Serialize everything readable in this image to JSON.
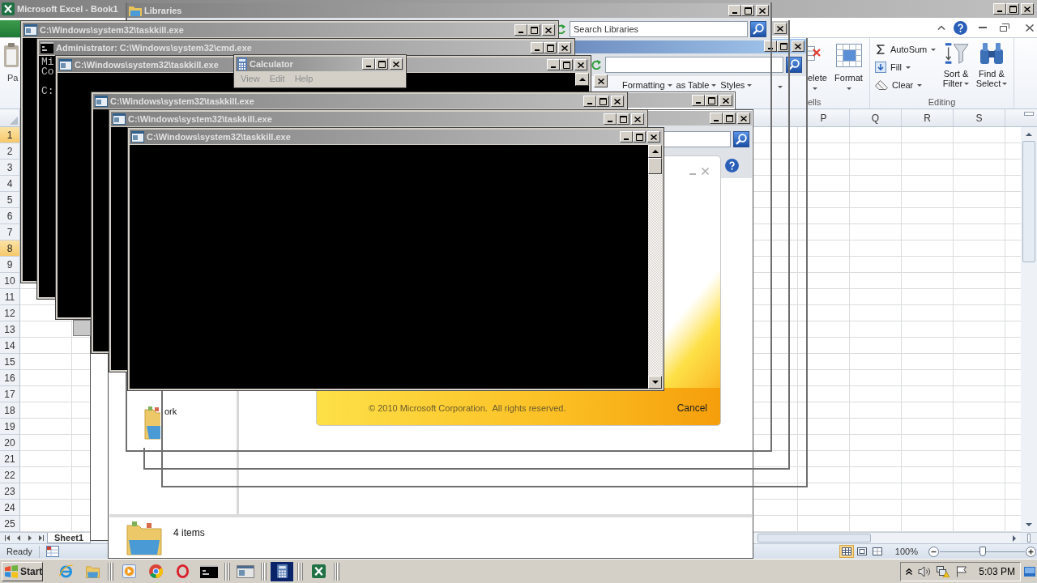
{
  "excel": {
    "title": "Microsoft Excel - Book1",
    "active": false,
    "ribbon": {
      "paste_label": "Pa",
      "styles": [
        "Formatting",
        "as Table",
        "Styles"
      ],
      "cells": {
        "delete_label": "elete",
        "format_label": "Format",
        "group_label": "ells"
      },
      "editing": {
        "commands": [
          {
            "kind": "sum",
            "label": "AutoSum"
          },
          {
            "kind": "fill",
            "label": "Fill"
          },
          {
            "kind": "clear",
            "label": "Clear"
          }
        ],
        "sort_lines": [
          "Sort &",
          "Filter"
        ],
        "find_lines": [
          "Find &",
          "Select"
        ],
        "group_label": "Editing"
      }
    },
    "columns": [
      "P",
      "Q",
      "R",
      "S"
    ],
    "rows": [
      {
        "label": "1",
        "selected": true
      },
      {
        "label": "2",
        "selected": false
      },
      {
        "label": "3",
        "selected": false
      },
      {
        "label": "4",
        "selected": false
      },
      {
        "label": "5",
        "selected": false
      },
      {
        "label": "6",
        "selected": false
      },
      {
        "label": "7",
        "selected": false
      },
      {
        "label": "8",
        "selected": true
      },
      {
        "label": "9",
        "selected": false
      },
      {
        "label": "10",
        "selected": false
      },
      {
        "label": "11",
        "selected": false
      },
      {
        "label": "12",
        "selected": false
      },
      {
        "label": "13",
        "selected": false
      },
      {
        "label": "14",
        "selected": false
      },
      {
        "label": "15",
        "selected": false
      },
      {
        "label": "16",
        "selected": false
      },
      {
        "label": "17",
        "selected": false
      },
      {
        "label": "18",
        "selected": false
      },
      {
        "label": "19",
        "selected": false
      },
      {
        "label": "20",
        "selected": false
      },
      {
        "label": "21",
        "selected": false
      },
      {
        "label": "22",
        "selected": false
      },
      {
        "label": "23",
        "selected": false
      },
      {
        "label": "24",
        "selected": false
      },
      {
        "label": "25",
        "selected": false
      }
    ],
    "sheet_tabs": [
      {
        "label": "Sheet1",
        "selected": true
      }
    ],
    "status": "Ready",
    "views": [
      {
        "kind": "normal",
        "selected": true
      },
      {
        "kind": "layout",
        "selected": false
      },
      {
        "kind": "breaks",
        "selected": false
      }
    ],
    "zoom": {
      "reading": "100%",
      "level": 0.5
    }
  },
  "windows": [
    {
      "kind": "explorer",
      "active": false,
      "title": "Libraries",
      "search": {
        "placeholder": "Search Libraries"
      }
    },
    {
      "kind": "console",
      "active": false,
      "title": "C:\\Windows\\system32\\taskkill.exe"
    },
    {
      "kind": "explorer",
      "active": false
    },
    {
      "kind": "prompt",
      "active": false,
      "title": "Administrator: C:\\Windows\\system32\\cmd.exe",
      "output": "Mi\nCo\n\nC:"
    },
    {
      "kind": "explorer",
      "active": true
    },
    {
      "kind": "console",
      "active": false,
      "title": "C:\\Windows\\system32\\taskkill.exe"
    },
    {
      "kind": "calculator",
      "active": false,
      "title": "Calculator",
      "menu": [
        {
          "label": "View",
          "disabled": true
        },
        {
          "label": "Edit",
          "disabled": true
        },
        {
          "label": "Help",
          "disabled": true
        }
      ]
    },
    {
      "kind": "explorer",
      "active": false
    },
    {
      "kind": "console",
      "active": false,
      "title": "C:\\Windows\\system32\\taskkill.exe"
    },
    {
      "kind": "console",
      "active": false,
      "title": "C:\\Windows\\system32\\taskkill.exe"
    },
    {
      "kind": "console",
      "active": false,
      "title": "C:\\Windows\\system32\\taskkill.exe"
    },
    {
      "kind": "splash",
      "copyright": "© 2010 Microsoft Corporation.  All rights reserved.",
      "cancel": "Cancel"
    },
    {
      "kind": "explorer",
      "active": false,
      "nav_item": "ork",
      "status": "4 items"
    }
  ],
  "taskbar": {
    "start": "Start",
    "items": [
      {
        "kind": "globe",
        "running": false,
        "selected": false
      },
      {
        "kind": "folder",
        "running": true,
        "selected": false
      },
      {
        "kind": "play",
        "running": false,
        "selected": false
      },
      {
        "kind": "ring",
        "running": false,
        "selected": false
      },
      {
        "kind": "oval",
        "running": false,
        "selected": false
      },
      {
        "kind": "console",
        "running": true,
        "selected": false
      },
      {
        "kind": "window",
        "running": true,
        "selected": false
      },
      {
        "kind": "calculator",
        "running": true,
        "selected": true
      },
      {
        "kind": "sheet",
        "running": true,
        "selected": false
      }
    ],
    "tray": [
      {
        "kind": "chevron"
      },
      {
        "kind": "speaker"
      },
      {
        "kind": "network"
      },
      {
        "kind": "flag"
      }
    ],
    "clock": "5:03 PM"
  }
}
